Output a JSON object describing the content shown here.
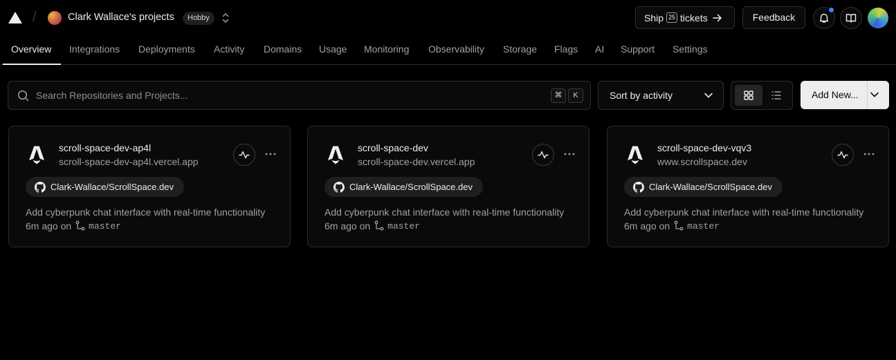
{
  "header": {
    "team_name": "Clark Wallace's projects",
    "plan": "Hobby",
    "ship_label": "Ship",
    "ship_count": "25",
    "ship_suffix": "tickets",
    "feedback_label": "Feedback",
    "notification_dot_color": "#3b82f6"
  },
  "tabs": [
    {
      "label": "Overview",
      "active": true
    },
    {
      "label": "Integrations"
    },
    {
      "label": "Deployments"
    },
    {
      "label": "Activity"
    },
    {
      "label": "Domains"
    },
    {
      "label": "Usage"
    },
    {
      "label": "Monitoring"
    },
    {
      "label": "Observability"
    },
    {
      "label": "Storage"
    },
    {
      "label": "Flags"
    },
    {
      "label": "AI"
    },
    {
      "label": "Support"
    },
    {
      "label": "Settings"
    }
  ],
  "toolbar": {
    "search_placeholder": "Search Repositories and Projects...",
    "kbd_cmd": "⌘",
    "kbd_k": "K",
    "sort_label": "Sort by activity",
    "view_selected": "grid",
    "add_new_label": "Add New..."
  },
  "projects": [
    {
      "name": "scroll-space-dev-ap4l",
      "url": "scroll-space-dev-ap4l.vercel.app",
      "repo": "Clark-Wallace/ScrollSpace.dev",
      "commit_message": "Add cyberpunk chat interface with real-time functionality",
      "time": "6m ago on",
      "branch": "master"
    },
    {
      "name": "scroll-space-dev",
      "url": "scroll-space-dev.vercel.app",
      "repo": "Clark-Wallace/ScrollSpace.dev",
      "commit_message": "Add cyberpunk chat interface with real-time functionality",
      "time": "6m ago on",
      "branch": "master"
    },
    {
      "name": "scroll-space-dev-vqv3",
      "url": "www.scrollspace.dev",
      "repo": "Clark-Wallace/ScrollSpace.dev",
      "commit_message": "Add cyberpunk chat interface with real-time functionality",
      "time": "6m ago on",
      "branch": "master"
    }
  ]
}
